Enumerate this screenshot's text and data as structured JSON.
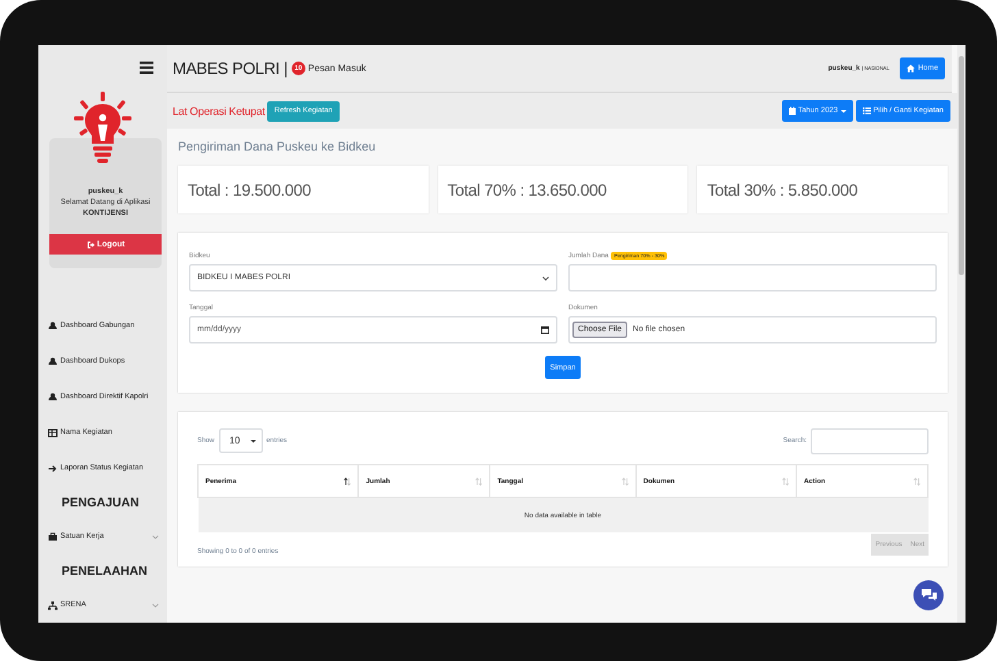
{
  "header": {
    "title": "MABES POLRI |",
    "badge": "10",
    "link": "Pesan Masuk",
    "user": "puskeu_k",
    "role": "| NASIONAL",
    "home": "Home"
  },
  "subheader": {
    "activity": "Lat Operasi Ketupat",
    "refresh": "Refresh Kegiatan",
    "year": "Tahun 2023",
    "pick": "Pilih / Ganti Kegiatan"
  },
  "sidebar": {
    "username": "puskeu_k",
    "welcome": "Selamat Datang di Aplikasi",
    "app": "KONTIJENSI",
    "logout": "Logout",
    "items": [
      {
        "kind": "link",
        "label": "Dashboard Gabungan"
      },
      {
        "kind": "link",
        "label": "Dashboard Dukops"
      },
      {
        "kind": "link",
        "label": "Dashboard Direktif Kapolri"
      },
      {
        "kind": "link",
        "label": "Nama Kegiatan"
      },
      {
        "kind": "link",
        "label": "Laporan Status Kegiatan"
      },
      {
        "kind": "heading",
        "label": "PENGAJUAN"
      },
      {
        "kind": "group",
        "label": "Satuan Kerja"
      },
      {
        "kind": "heading",
        "label": "PENELAAHAN"
      },
      {
        "kind": "group",
        "label": "SRENA"
      }
    ]
  },
  "page_title": "Pengiriman Dana Puskeu ke Bidkeu",
  "totals": [
    "Total : 19.500.000",
    "Total 70% : 13.650.000",
    "Total 30% : 5.850.000"
  ],
  "form": {
    "fields": [
      {
        "kind": "select",
        "label": "Bidkeu",
        "value": "BIDKEU I MABES POLRI"
      },
      {
        "kind": "text",
        "label": "Jumlah Dana",
        "badge": "Pengiriman 70% - 30%"
      },
      {
        "kind": "date",
        "label": "Tanggal",
        "placeholder": "mm/dd/yyyy"
      },
      {
        "kind": "file",
        "label": "Dokumen",
        "button": "Choose File",
        "value": "No file chosen"
      }
    ],
    "submit": "Simpan"
  },
  "table": {
    "show": "Show",
    "length": "10",
    "entries": "entries",
    "search": "Search:",
    "columns": [
      {
        "label": "Penerima",
        "sorted": true
      },
      {
        "label": "Jumlah",
        "sorted": false
      },
      {
        "label": "Tanggal",
        "sorted": false
      },
      {
        "label": "Dokumen",
        "sorted": false
      },
      {
        "label": "Action",
        "sorted": false
      }
    ],
    "empty": "No data available in table",
    "info": "Showing 0 to 0 of 0 entries",
    "pagination": [
      {
        "label": "Previous",
        "disabled": true
      },
      {
        "label": "Next",
        "disabled": true
      }
    ]
  }
}
